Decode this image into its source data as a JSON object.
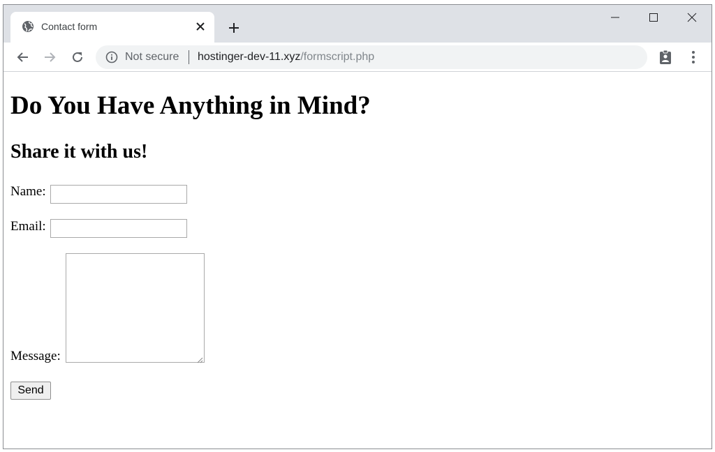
{
  "tab": {
    "title": "Contact form",
    "favicon": "globe-icon"
  },
  "address_bar": {
    "security_label": "Not secure",
    "host": "hostinger-dev-11.xyz",
    "path": "/formscript.php"
  },
  "page": {
    "heading": "Do You Have Anything in Mind?",
    "subheading": "Share it with us!",
    "form": {
      "name_label": "Name:",
      "name_value": "",
      "email_label": "Email:",
      "email_value": "",
      "message_label": "Message:",
      "message_value": "",
      "send_label": "Send"
    }
  },
  "colors": {
    "tabstrip": "#dee1e6",
    "omnibox": "#f1f3f4",
    "url_path": "#80868b"
  }
}
